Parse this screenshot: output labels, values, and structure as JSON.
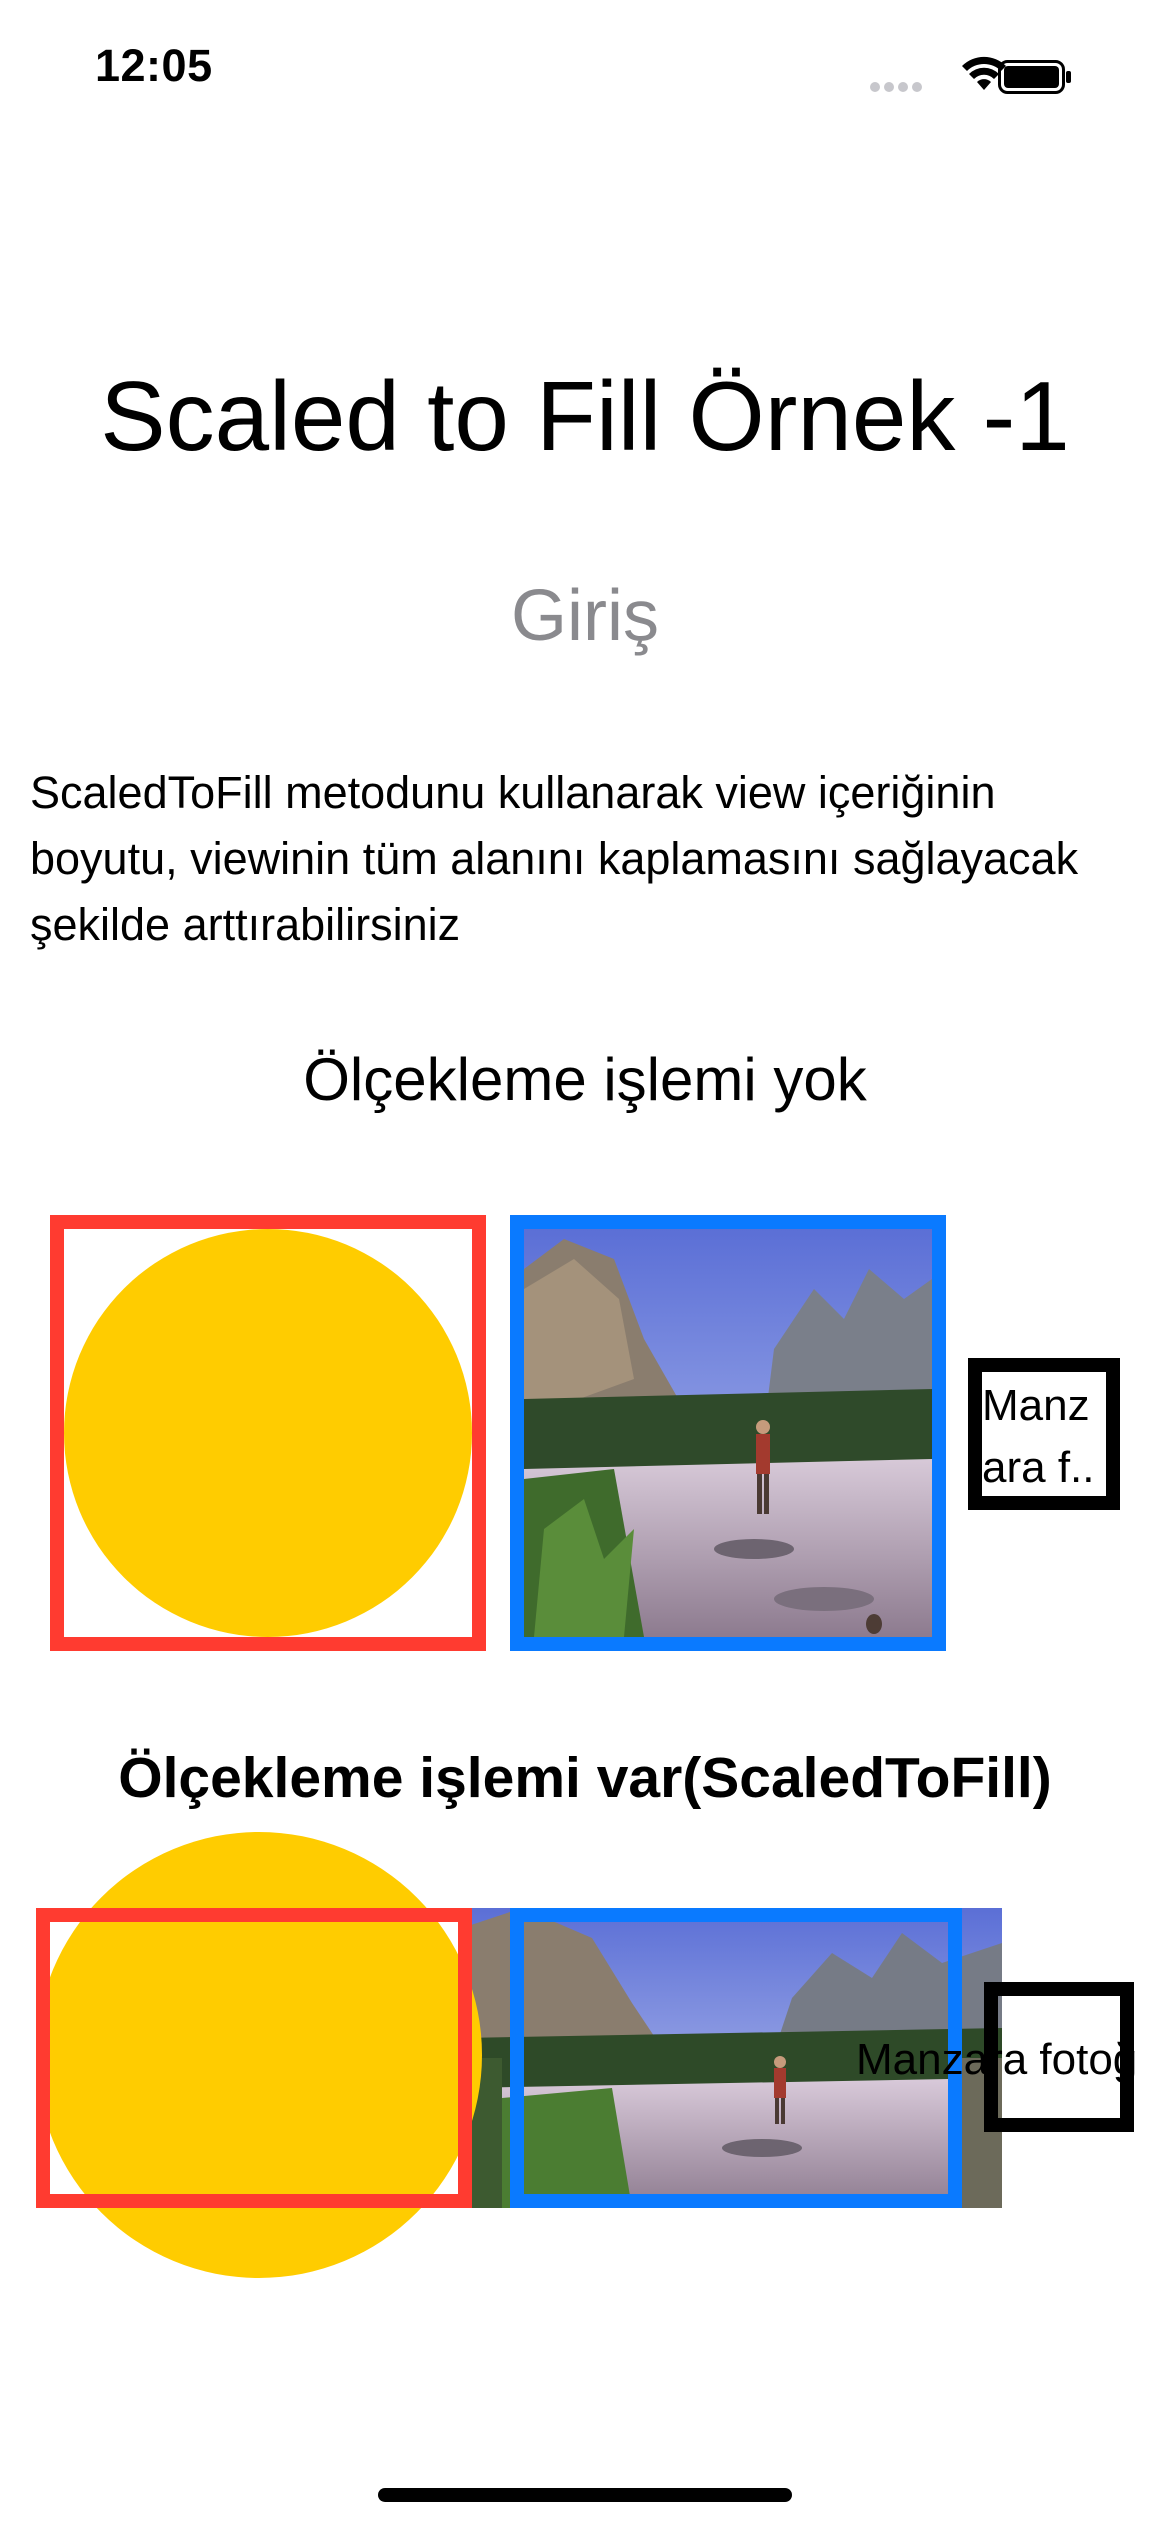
{
  "status_bar": {
    "time": "12:05",
    "icons": [
      "cellular-signal-icon",
      "wifi-icon",
      "battery-icon"
    ]
  },
  "header": {
    "title": "Scaled to Fill Örnek -1",
    "subtitle": "Giriş"
  },
  "description": "ScaledToFill metodunu kullanarak view içeriğinin boyutu, viewinin tüm alanını kaplamasını sağlayacak şekilde arttırabilirsiniz",
  "section_no_scale": {
    "heading": "Ölçekleme işlemi yok",
    "text_box_line1": "Manz",
    "text_box_line2": "ara f.."
  },
  "section_scaled": {
    "heading": "Ölçekleme işlemi var(ScaledToFill)",
    "text_box_label": "Manzara fotoğ"
  },
  "colors": {
    "red": "#ff3b30",
    "blue": "#0a7aff",
    "yellow": "#ffcc00",
    "gray": "#8a8a8e"
  }
}
